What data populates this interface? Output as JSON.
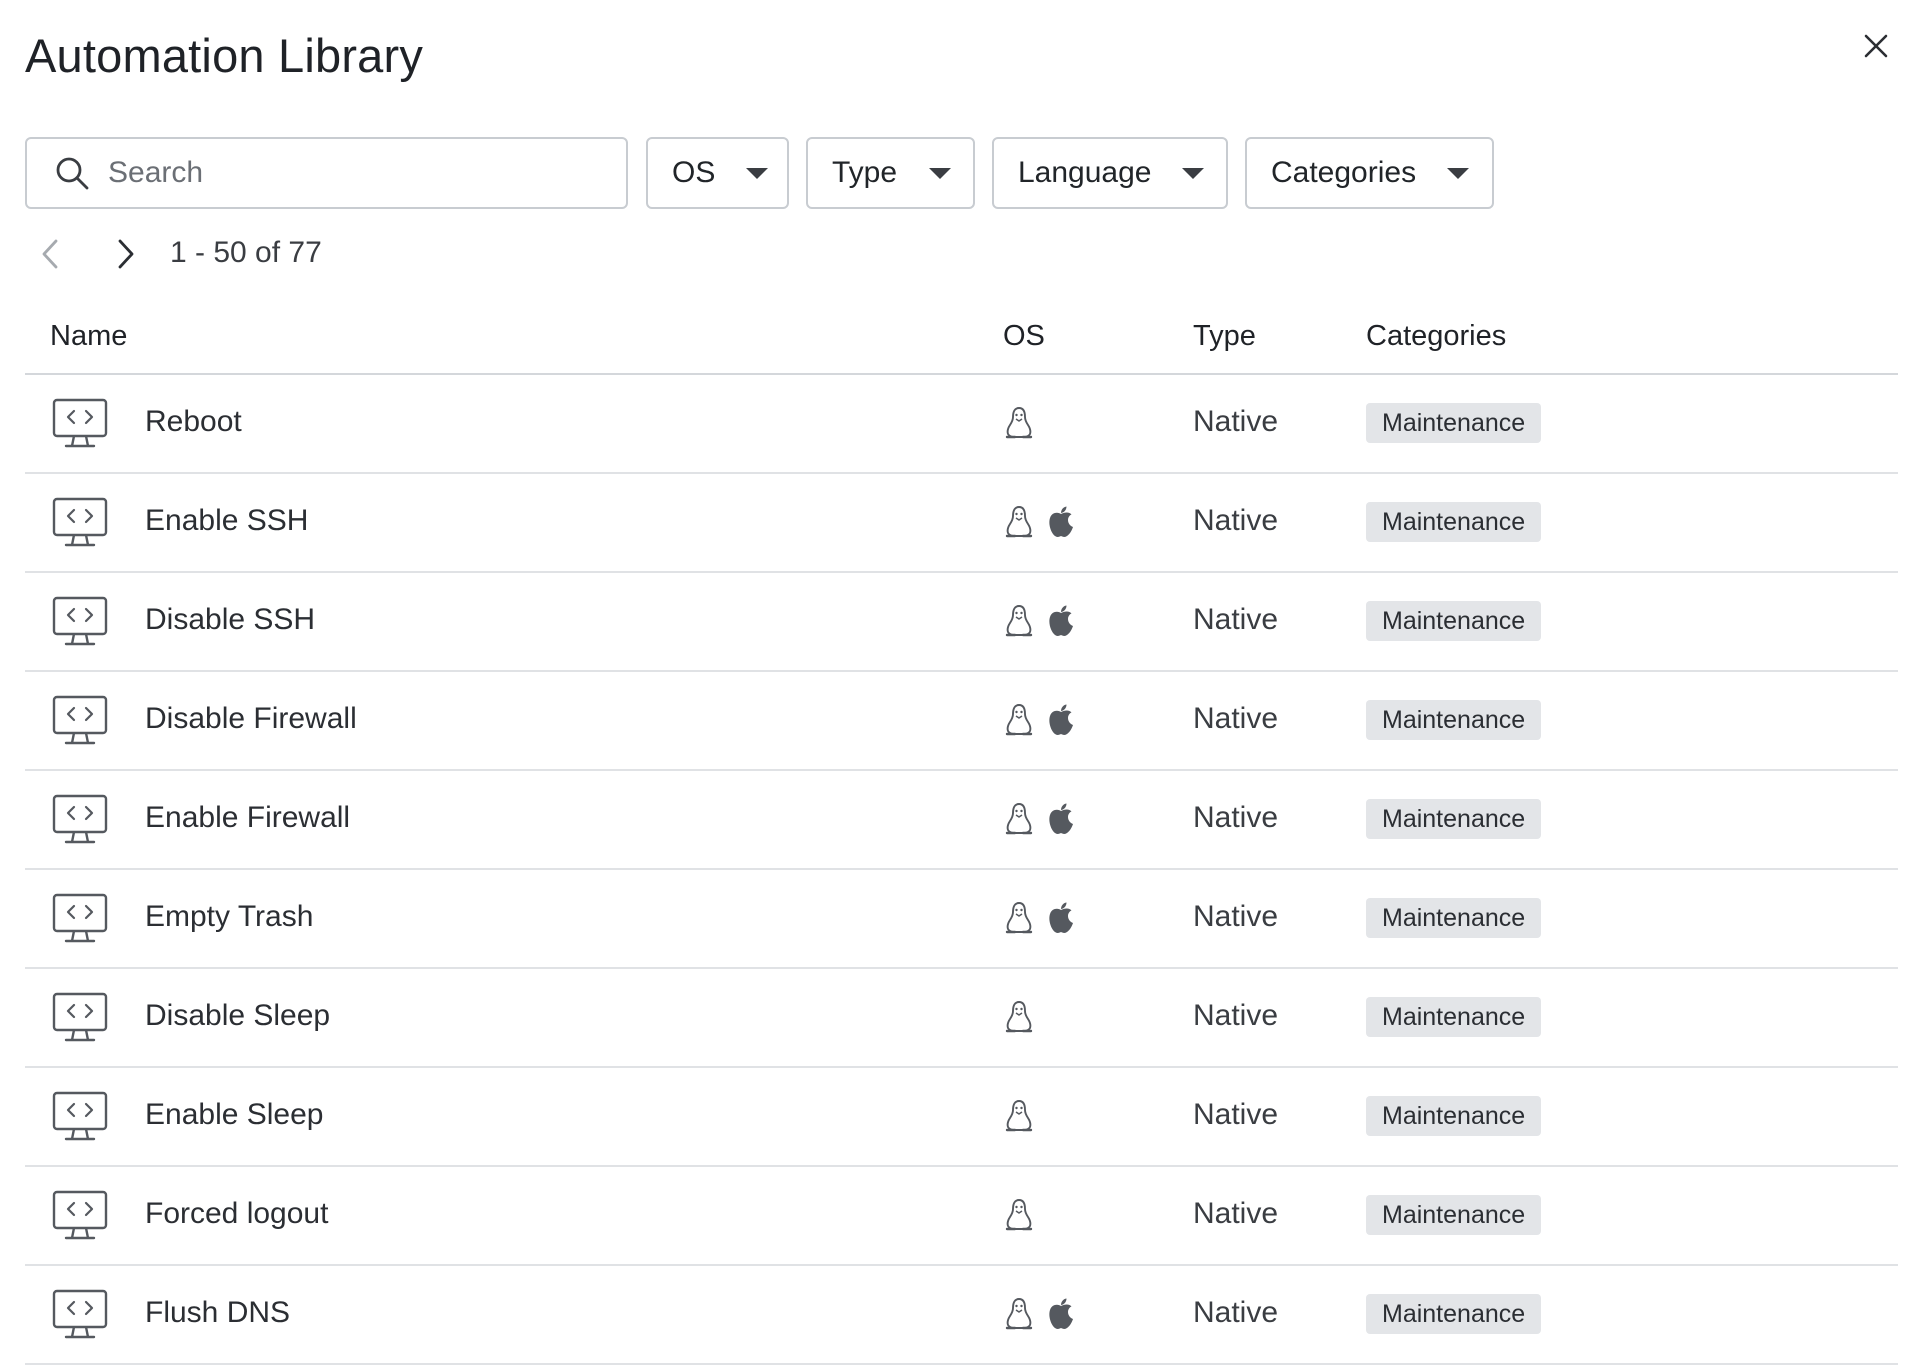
{
  "header": {
    "title": "Automation Library"
  },
  "filters": {
    "search_placeholder": "Search",
    "search_value": "",
    "dropdowns": [
      {
        "label": "OS"
      },
      {
        "label": "Type"
      },
      {
        "label": "Language"
      },
      {
        "label": "Categories"
      }
    ]
  },
  "pager": {
    "range_text": "1 - 50 of 77"
  },
  "table": {
    "columns": [
      "Name",
      "OS",
      "Type",
      "Categories"
    ],
    "rows": [
      {
        "name": "Reboot",
        "os": [
          "linux"
        ],
        "type": "Native",
        "category": "Maintenance"
      },
      {
        "name": "Enable SSH",
        "os": [
          "linux",
          "apple"
        ],
        "type": "Native",
        "category": "Maintenance"
      },
      {
        "name": "Disable SSH",
        "os": [
          "linux",
          "apple"
        ],
        "type": "Native",
        "category": "Maintenance"
      },
      {
        "name": "Disable Firewall",
        "os": [
          "linux",
          "apple"
        ],
        "type": "Native",
        "category": "Maintenance"
      },
      {
        "name": "Enable Firewall",
        "os": [
          "linux",
          "apple"
        ],
        "type": "Native",
        "category": "Maintenance"
      },
      {
        "name": "Empty Trash",
        "os": [
          "linux",
          "apple"
        ],
        "type": "Native",
        "category": "Maintenance"
      },
      {
        "name": "Disable Sleep",
        "os": [
          "linux"
        ],
        "type": "Native",
        "category": "Maintenance"
      },
      {
        "name": "Enable Sleep",
        "os": [
          "linux"
        ],
        "type": "Native",
        "category": "Maintenance"
      },
      {
        "name": "Forced logout",
        "os": [
          "linux"
        ],
        "type": "Native",
        "category": "Maintenance"
      },
      {
        "name": "Flush DNS",
        "os": [
          "linux",
          "apple"
        ],
        "type": "Native",
        "category": "Maintenance"
      }
    ]
  },
  "icons": {
    "row_icon": "code-monitor-icon",
    "linux": "linux-icon",
    "apple": "apple-icon",
    "close": "close-icon",
    "search": "search-icon",
    "prev": "chevron-left-icon",
    "next": "chevron-right-icon",
    "dropdown": "caret-down-icon"
  },
  "colors": {
    "badge_bg": "#e3e5e8",
    "border": "#c8ccd1",
    "icon": "#55595f"
  }
}
